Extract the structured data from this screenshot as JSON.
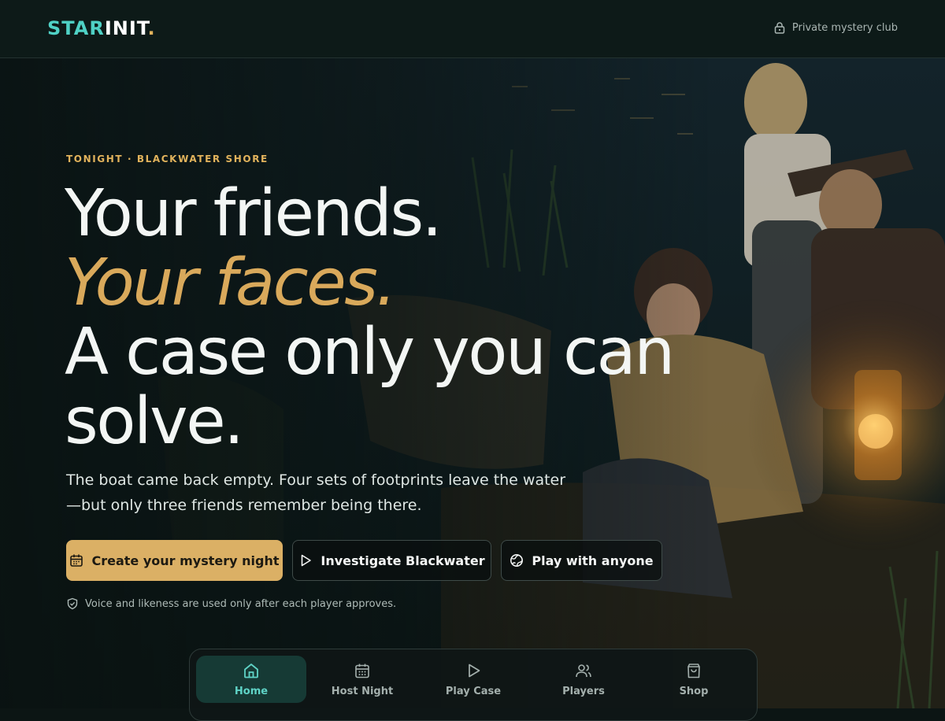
{
  "brand": {
    "part1": "STAR",
    "part2": "INIT",
    "dot": ".",
    "colors": {
      "accent": "#4fd1c5",
      "gold": "#e2b35c"
    }
  },
  "header": {
    "club_label": "Private mystery club",
    "club_icon": "lock-icon"
  },
  "hero": {
    "eyebrow": "TONIGHT · BLACKWATER SHORE",
    "headline_1": "Your friends.",
    "headline_2": "Your faces.",
    "headline_3a": "A case only you can",
    "headline_3b": "solve.",
    "subtitle_1": "The boat came back empty. Four sets of footprints leave the water",
    "subtitle_2": "—but only three friends remember being there.",
    "background": "night-lakeshore-photo"
  },
  "actions": {
    "primary": {
      "label": "Create your mystery night",
      "icon": "calendar-icon",
      "color": "#dbb065"
    },
    "secondary": {
      "label": "Investigate Blackwater",
      "icon": "play-icon"
    },
    "tertiary": {
      "label": "Play with anyone",
      "icon": "globe-icon"
    }
  },
  "consent": {
    "text": "Voice and likeness are used only after each player approves.",
    "icon": "shield-check-icon"
  },
  "nav": {
    "items": [
      {
        "label": "Home",
        "icon": "home-icon",
        "active": true
      },
      {
        "label": "Host Night",
        "icon": "calendar-icon",
        "active": false
      },
      {
        "label": "Play Case",
        "icon": "play-icon",
        "active": false
      },
      {
        "label": "Players",
        "icon": "users-icon",
        "active": false
      },
      {
        "label": "Shop",
        "icon": "bag-icon",
        "active": false
      }
    ]
  }
}
